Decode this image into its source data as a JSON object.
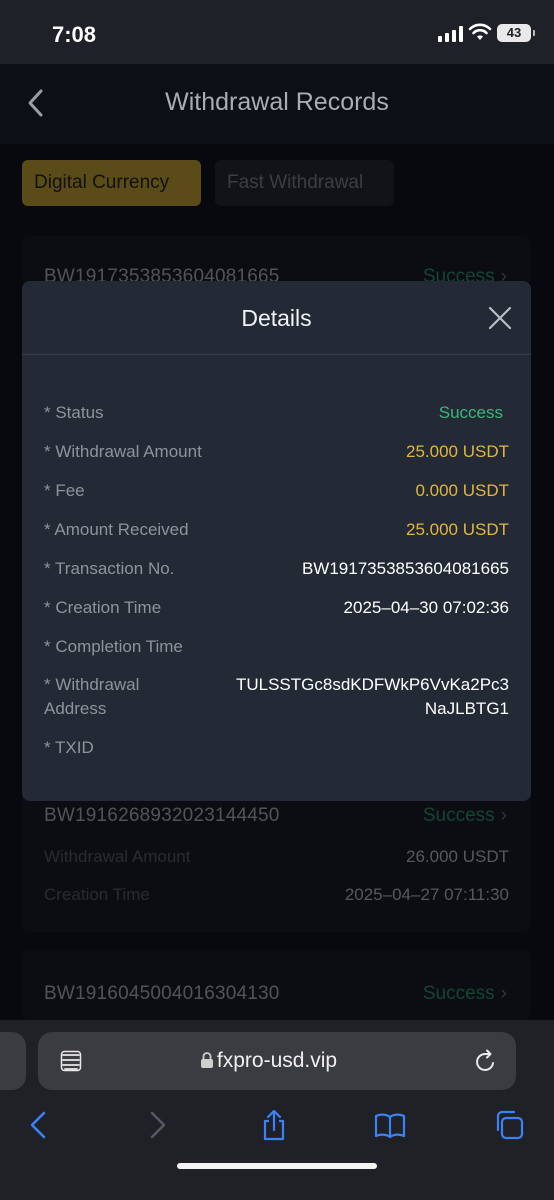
{
  "status_bar": {
    "time": "7:08",
    "battery": "43"
  },
  "header": {
    "title": "Withdrawal Records"
  },
  "tabs": [
    {
      "label": "Digital Currency",
      "active": true
    },
    {
      "label": "Fast Withdrawal",
      "active": false
    }
  ],
  "records": [
    {
      "id": "BW1917353853604081665",
      "status": "Success"
    },
    {
      "id": "BW1916268932023144450",
      "status": "Success",
      "amount_label": "Withdrawal Amount",
      "amount": "26.000 USDT",
      "time_label": "Creation Time",
      "time": "2025–04–27 07:11:30"
    },
    {
      "id": "BW1916045004016304130",
      "status": "Success"
    }
  ],
  "modal": {
    "title": "Details",
    "rows": [
      {
        "label": "* Status",
        "value": "Success"
      },
      {
        "label": "* Withdrawal Amount",
        "value": "25.000 USDT"
      },
      {
        "label": "* Fee",
        "value": "0.000 USDT"
      },
      {
        "label": "* Amount Received",
        "value": "25.000 USDT"
      },
      {
        "label": "* Transaction No.",
        "value": "BW1917353853604081665"
      },
      {
        "label": "* Creation Time",
        "value": "2025–04–30 07:02:36"
      },
      {
        "label": "* Completion Time",
        "value": ""
      },
      {
        "label_line1": "* Withdrawal",
        "label_line2": "Address",
        "value_line1": "TULSSTGc8sdKDFWkP6VvKa2Pc3",
        "value_line2": "NaJLBTG1"
      },
      {
        "label": "* TXID",
        "value": ""
      }
    ]
  },
  "browser": {
    "url": "fxpro-usd.vip"
  },
  "colors": {
    "accent": "#8c7427",
    "success": "#3cb77b",
    "amount": "#e2b63b",
    "modal_bg": "#232a36"
  }
}
